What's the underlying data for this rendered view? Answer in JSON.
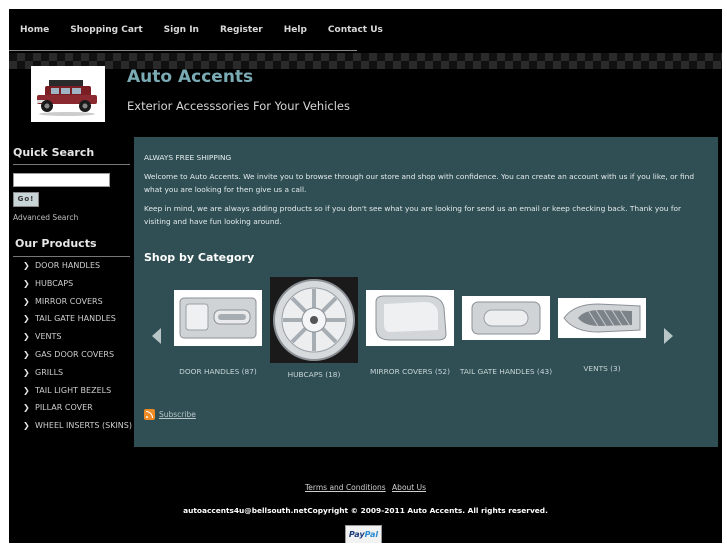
{
  "nav": {
    "items": [
      "Home",
      "Shopping Cart",
      "Sign In",
      "Register",
      "Help",
      "Contact Us"
    ]
  },
  "header": {
    "title": "Auto Accents",
    "tagline": "Exterior Accesssories For Your Vehicles"
  },
  "sidebar": {
    "quick_search_heading": "Quick Search",
    "search_value": "",
    "go_label": "Go!",
    "advanced_search": "Advanced Search",
    "products_heading": "Our Products",
    "products": [
      "DOOR HANDLES",
      "HUBCAPS",
      "MIRROR COVERS",
      "TAIL GATE HANDLES",
      "VENTS",
      "GAS DOOR COVERS",
      "GRILLS",
      "TAIL LIGHT BEZELS",
      "PILLAR COVER",
      "WHEEL INSERTS (SKINS)"
    ]
  },
  "main": {
    "free_shipping": "ALWAYS FREE SHIPPING",
    "welcome": "Welcome to Auto Accents. We invite you to browse through our store and shop with confidence. You can create an account with us if you like, or find what you are looking for then give us a call.",
    "keep_in_mind": "Keep in mind, we are always adding products so if you don't see what you are looking for send us an email or keep checking back. Thank you for visiting and have fun looking around.",
    "shop_by_category": "Shop by Category",
    "categories": [
      {
        "label": "DOOR HANDLES (87)"
      },
      {
        "label": "HUBCAPS (18)"
      },
      {
        "label": "MIRROR COVERS (52)"
      },
      {
        "label": "TAIL GATE HANDLES (43)"
      },
      {
        "label": "VENTS (3)"
      }
    ],
    "subscribe": "Subscribe"
  },
  "footer": {
    "terms": "Terms and Conditions",
    "about": "About Us",
    "copyright": "autoaccents4u@bellsouth.netCopyright © 2009-2011 Auto Accents. All rights reserved.",
    "paypal_1": "Pay",
    "paypal_2": "Pal"
  },
  "colors": {
    "panel": "#2f4f55",
    "title": "#7aaab4",
    "background": "#000000"
  }
}
